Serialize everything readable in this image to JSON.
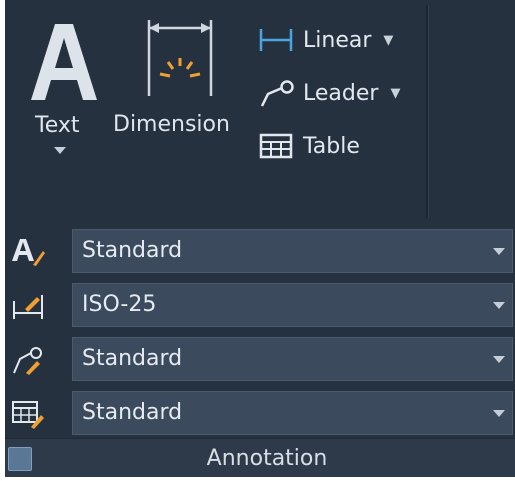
{
  "panel": {
    "text_button": {
      "label": "Text"
    },
    "dimension_button": {
      "label": "Dimension"
    },
    "linear_button": {
      "label": "Linear"
    },
    "leader_button": {
      "label": "Leader"
    },
    "table_button": {
      "label": "Table"
    },
    "rows": [
      {
        "icon": "text-style-icon",
        "value": "Standard"
      },
      {
        "icon": "dimension-style-icon",
        "value": "ISO-25"
      },
      {
        "icon": "multileader-style-icon",
        "value": "Standard"
      },
      {
        "icon": "table-style-icon",
        "value": "Standard"
      }
    ],
    "footer_title": "Annotation"
  },
  "colors": {
    "background": "#263140",
    "combo": "#3b4a5d",
    "accent_orange": "#f0a030",
    "accent_blue": "#4aa3df",
    "footer": "#2e3a49"
  }
}
